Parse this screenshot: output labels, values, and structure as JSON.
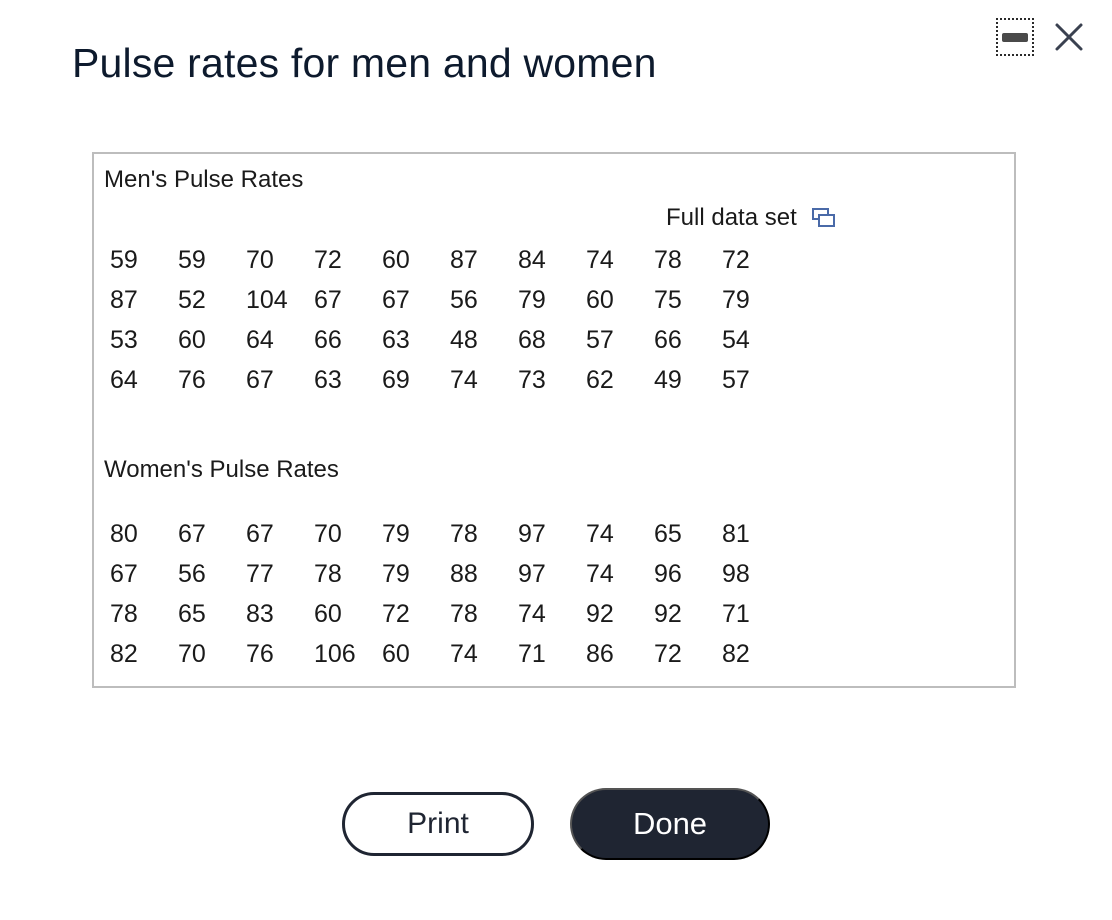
{
  "dialog": {
    "title": "Pulse rates for men and women"
  },
  "window_controls": {
    "minimize_icon": "minimize-icon",
    "close_icon": "close-icon"
  },
  "men": {
    "heading": "Men's Pulse Rates",
    "full_data_set_label": "Full data set",
    "full_data_set_icon": "popout-windows-icon",
    "rows": [
      [
        "59",
        "59",
        "70",
        "72",
        "60",
        "87",
        "84",
        "74",
        "78",
        "72"
      ],
      [
        "87",
        "52",
        "104",
        "67",
        "67",
        "56",
        "79",
        "60",
        "75",
        "79"
      ],
      [
        "53",
        "60",
        "64",
        "66",
        "63",
        "48",
        "68",
        "57",
        "66",
        "54"
      ],
      [
        "64",
        "76",
        "67",
        "63",
        "69",
        "74",
        "73",
        "62",
        "49",
        "57"
      ]
    ]
  },
  "women": {
    "heading": "Women's Pulse Rates",
    "rows": [
      [
        "80",
        "67",
        "67",
        "70",
        "79",
        "78",
        "97",
        "74",
        "65",
        "81"
      ],
      [
        "67",
        "56",
        "77",
        "78",
        "79",
        "88",
        "97",
        "74",
        "96",
        "98"
      ],
      [
        "78",
        "65",
        "83",
        "60",
        "72",
        "78",
        "74",
        "92",
        "92",
        "71"
      ],
      [
        "82",
        "70",
        "76",
        "106",
        "60",
        "74",
        "71",
        "86",
        "72",
        "82"
      ]
    ]
  },
  "buttons": {
    "print_label": "Print",
    "done_label": "Done"
  },
  "colors": {
    "primary_dark": "#1f2532",
    "panel_border": "#bdbdbd",
    "popout_icon": "#4a6aa8"
  }
}
